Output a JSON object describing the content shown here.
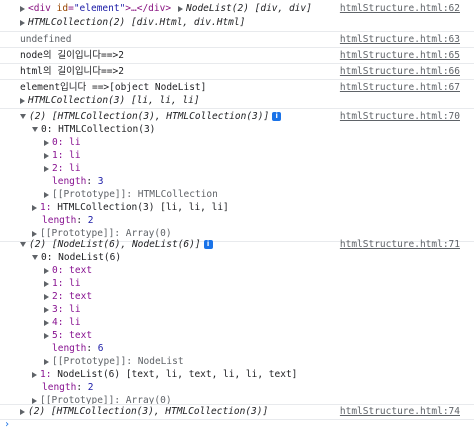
{
  "rows": {
    "r1": {
      "open_tag": "<div",
      "attr_name": "id",
      "attr_value": "\"element\"",
      "rest": ">…</div>",
      "nodelist": "NodeList(2) [div, div]",
      "src": "htmlStructure.html:62"
    },
    "r2": {
      "text": "HTMLCollection(2) [div.Html, div.Html]"
    },
    "r3": {
      "text": "undefined",
      "src": "htmlStructure.html:63"
    },
    "r4": {
      "text": "node의 길이입니다==>2",
      "src": "htmlStructure.html:65"
    },
    "r5": {
      "text": "html의 길이입니다==>2",
      "src": "htmlStructure.html:66"
    },
    "r6": {
      "text": "element입니다 ==>[object NodeList]",
      "src": "htmlStructure.html:67"
    },
    "r7": {
      "text": "HTMLCollection(3) [li, li, li]"
    },
    "g1": {
      "header": "(2) [HTMLCollection(3), HTMLCollection(3)]",
      "src": "htmlStructure.html:70",
      "item0": "0: HTMLCollection(3)",
      "sub": [
        "0: li",
        "1: li",
        "2: li"
      ],
      "length_key": "length",
      "length_val": "3",
      "proto": "[[Prototype]]: HTMLCollection",
      "item1_key": "1:",
      "item1_val": "HTMLCollection(3) [li, li, li]",
      "outer_length_val": "2",
      "outer_proto": "[[Prototype]]: Array(0)"
    },
    "g2": {
      "header": "(2) [NodeList(6), NodeList(6)]",
      "src": "htmlStructure.html:71",
      "item0": "0: NodeList(6)",
      "sub": [
        "0: text",
        "1: li",
        "2: text",
        "3: li",
        "4: li",
        "5: text"
      ],
      "length_key": "length",
      "length_val": "6",
      "proto": "[[Prototype]]: NodeList",
      "item1_key": "1:",
      "item1_val": "NodeList(6) [text, li, text, li, li, text]",
      "outer_length_val": "2",
      "outer_proto": "[[Prototype]]: Array(0)"
    },
    "g3": {
      "header": "(2) [HTMLCollection(3), HTMLCollection(3)]",
      "src": "htmlStructure.html:74"
    }
  },
  "info_icon_label": "i",
  "prompt_glyph": "›"
}
